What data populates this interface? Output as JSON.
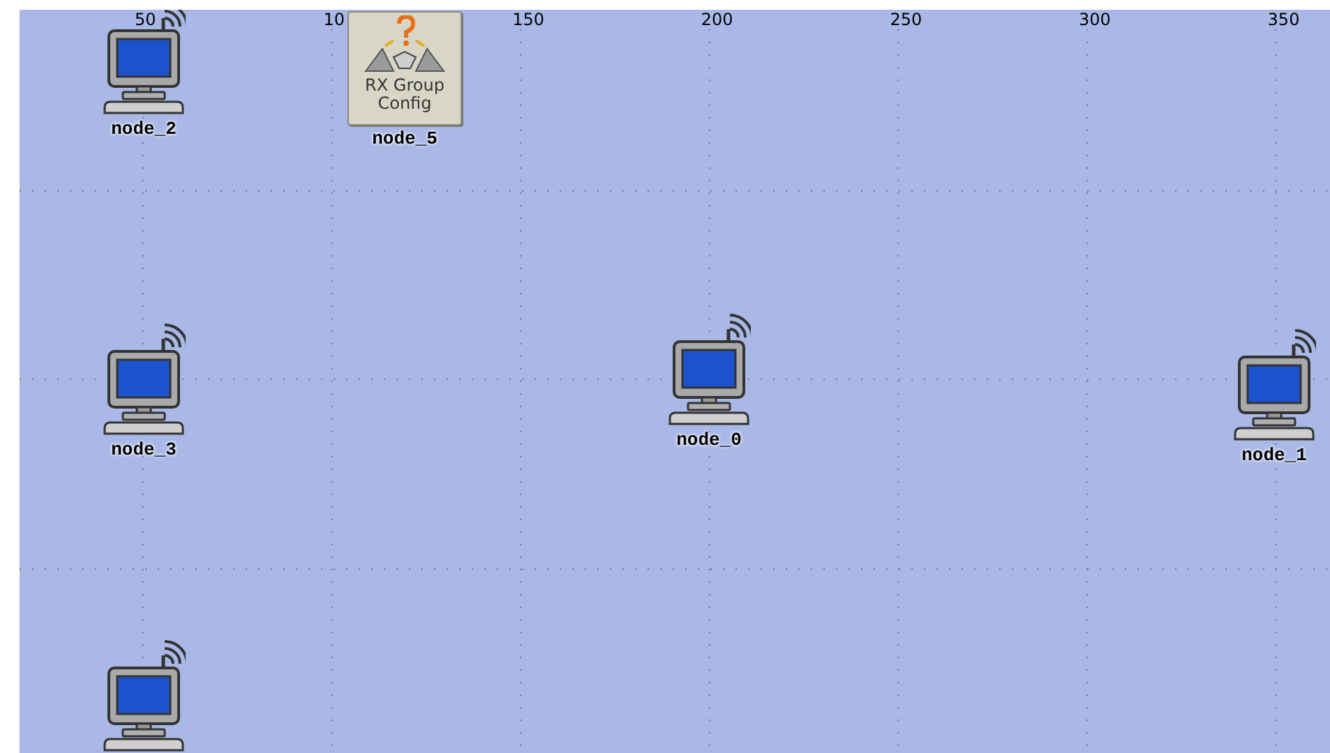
{
  "axis": {
    "ticks": [
      "50",
      "10",
      "150",
      "200",
      "250",
      "300",
      "350"
    ]
  },
  "nodes": [
    {
      "kind": "computer",
      "label": "node_2"
    },
    {
      "kind": "config",
      "label": "node_5",
      "text": "RX Group Config"
    },
    {
      "kind": "computer",
      "label": "node_3"
    },
    {
      "kind": "computer",
      "label": "node_0"
    },
    {
      "kind": "computer",
      "label": "node_1"
    },
    {
      "kind": "computer"
    }
  ]
}
